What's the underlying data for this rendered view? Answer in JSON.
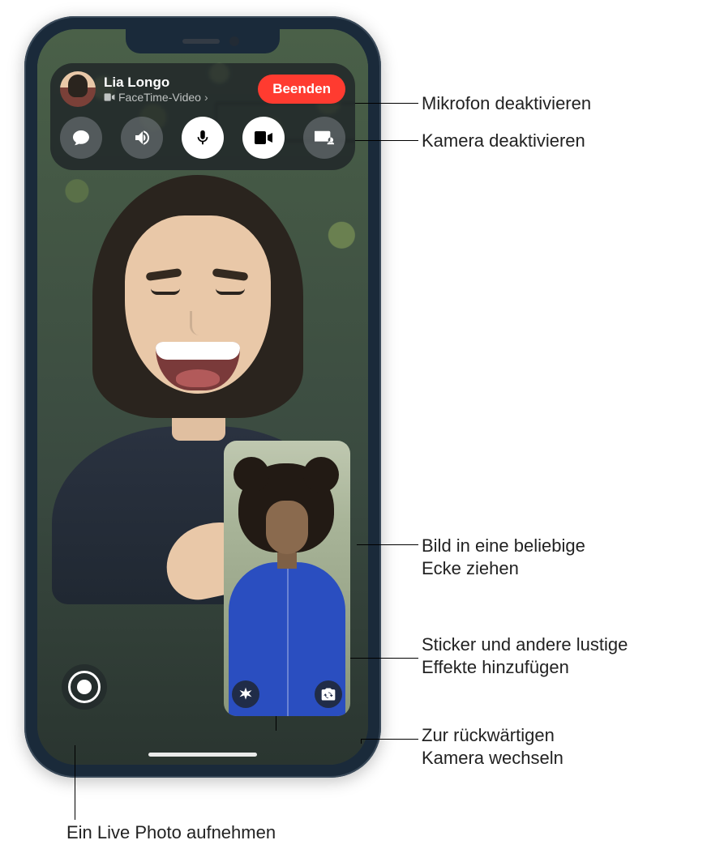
{
  "caller": {
    "name": "Lia Longo",
    "subtitle": "FaceTime-Video",
    "avatar_alt": "caller-avatar"
  },
  "controls": {
    "end_label": "Beenden",
    "messages_icon": "messages-icon",
    "speaker_icon": "speaker-icon",
    "mic_icon": "microphone-icon",
    "camera_icon": "camera-icon",
    "share_screen_icon": "share-screen-icon"
  },
  "pip": {
    "effects_icon": "effects-icon",
    "flip_icon": "flip-camera-icon"
  },
  "live_photo_icon": "live-photo-icon",
  "callouts": {
    "mute_mic": "Mikrofon deaktivieren",
    "mute_cam": "Kamera deaktivieren",
    "drag_pip": "Bild in eine beliebige\nEcke ziehen",
    "effects": "Sticker und andere lustige\nEffekte hinzufügen",
    "flip": "Zur rückwärtigen\nKamera wechseln",
    "live_photo": "Ein Live Photo aufnehmen"
  }
}
